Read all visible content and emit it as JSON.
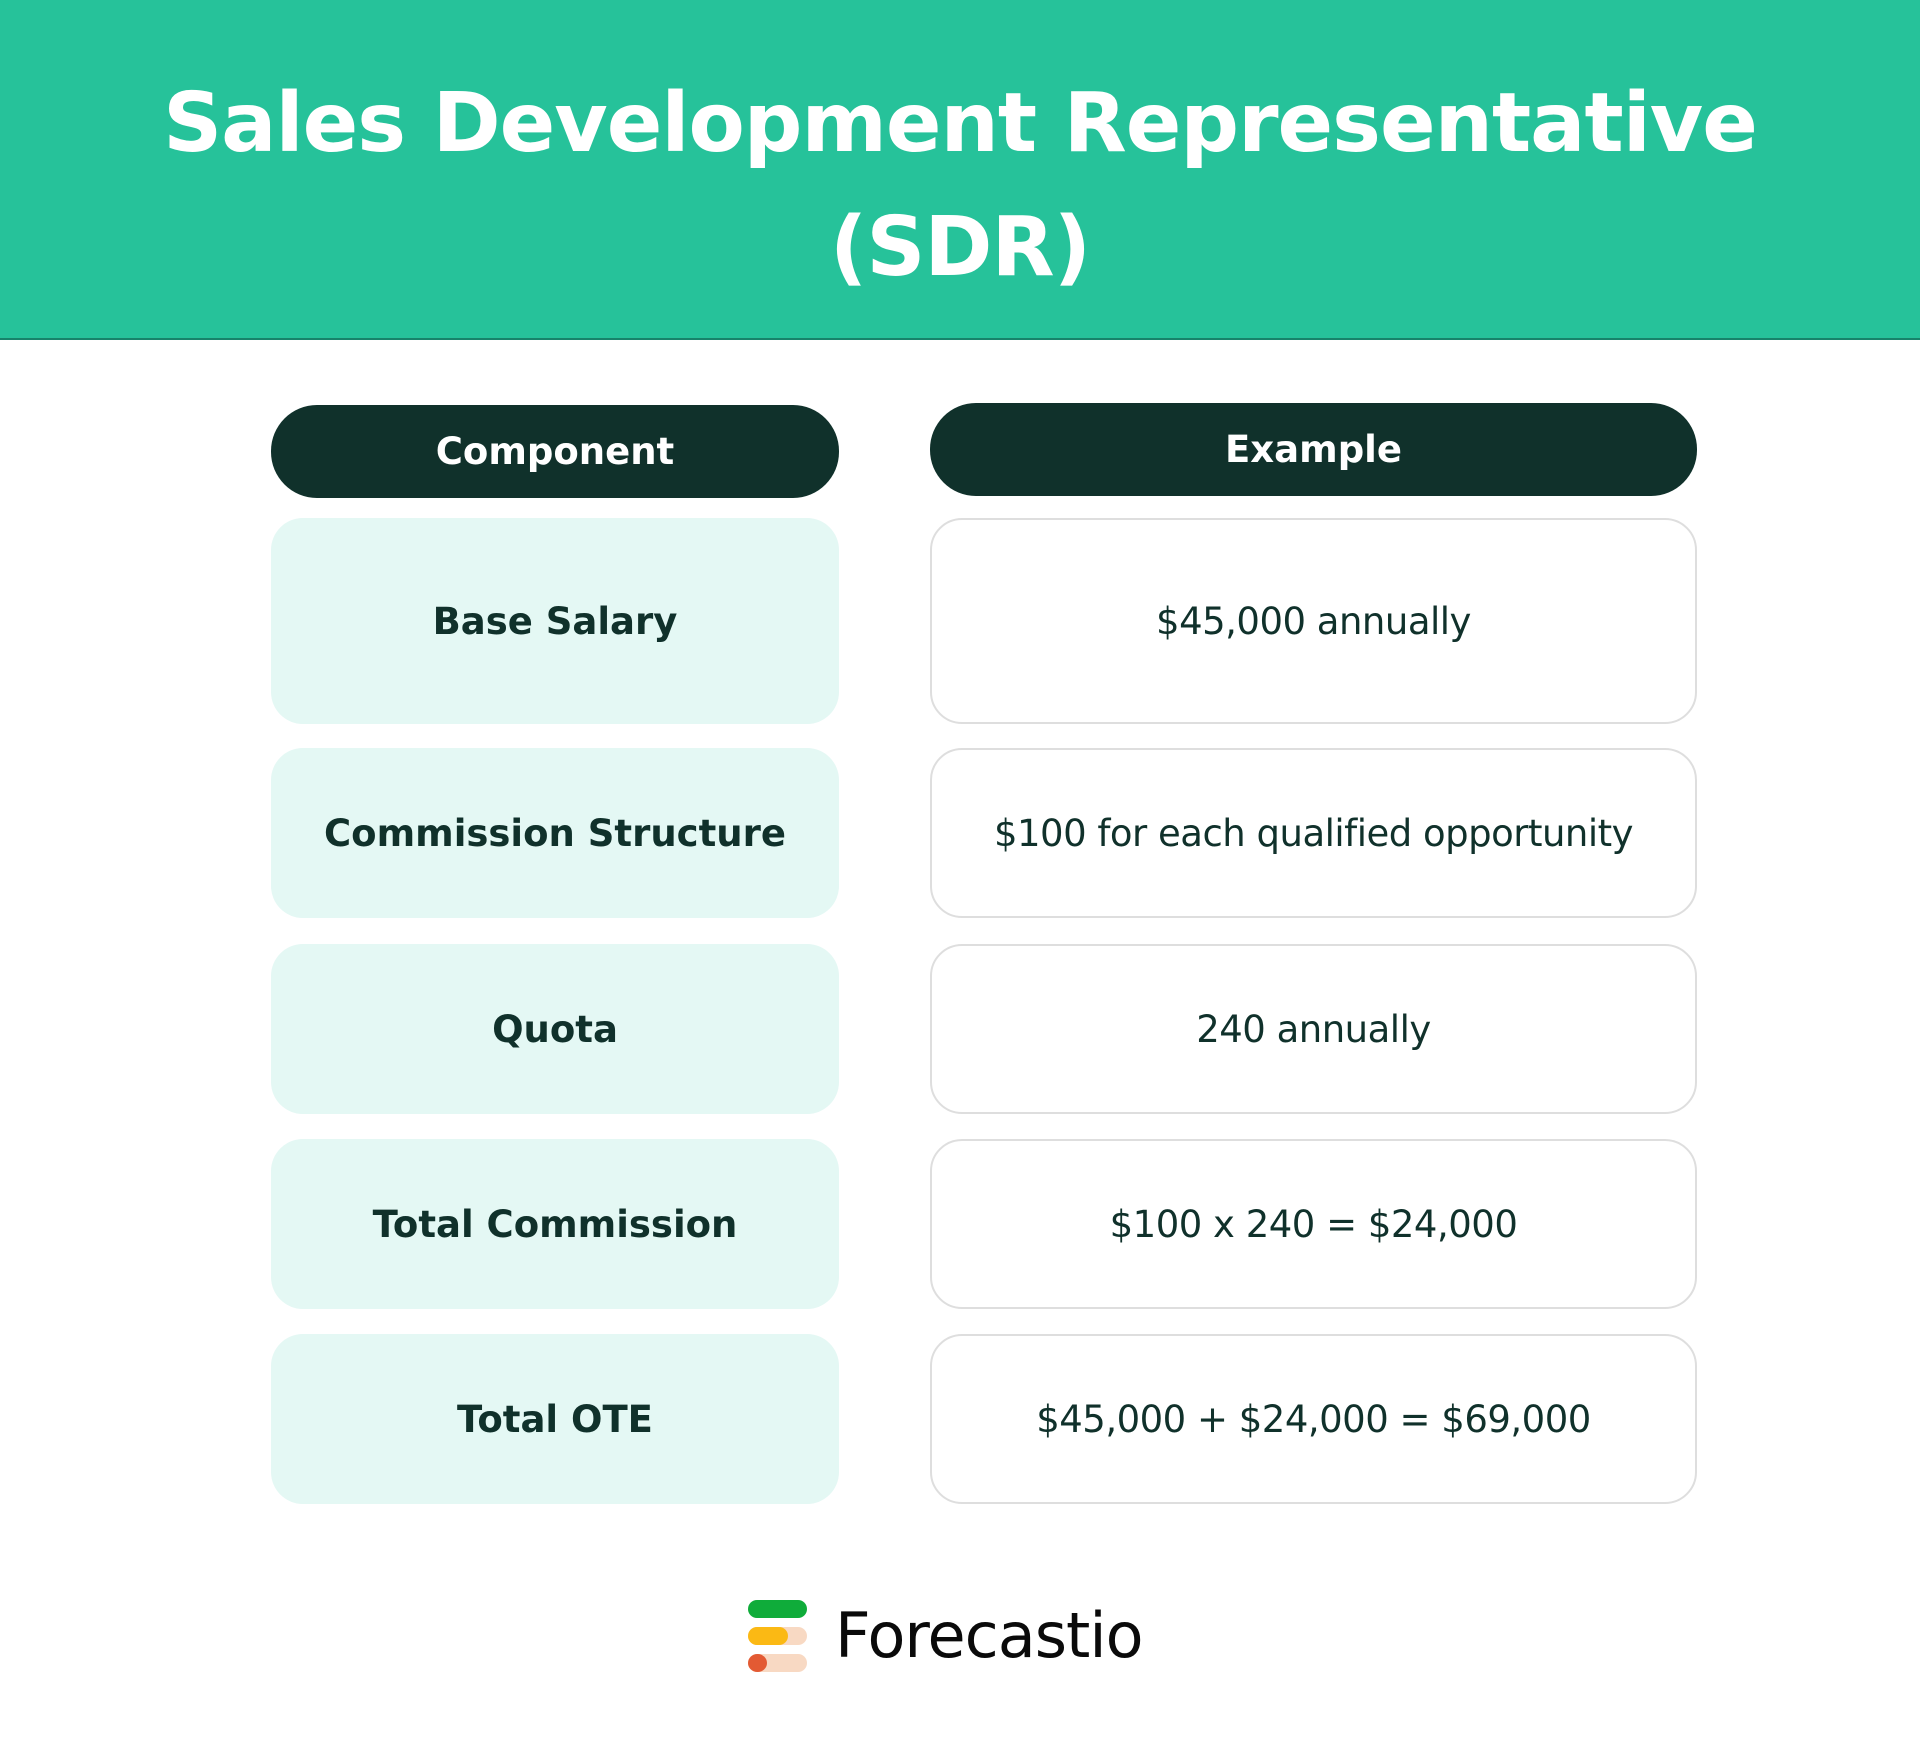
{
  "header": {
    "title_line1": "Sales Development Representative",
    "title_line2": "(SDR)",
    "background_color": "#26c29a"
  },
  "table": {
    "columns": [
      "Component",
      "Example"
    ],
    "rows": [
      {
        "component": "Base Salary",
        "example": "$45,000 annually"
      },
      {
        "component": "Commission Structure",
        "example": "$100 for each qualified opportunity"
      },
      {
        "component": "Quota",
        "example": "240 annually"
      },
      {
        "component": "Total Commission",
        "example": "$100 x 240 = $24,000"
      },
      {
        "component": "Total OTE",
        "example": "$45,000 + $24,000 = $69,000"
      }
    ],
    "header_color": "#10312b",
    "component_cell_color": "#e4f8f4"
  },
  "footer": {
    "logo_icon": "forecastio-bars-icon",
    "brand_name": "Forecastio",
    "logo_colors": [
      "#0fac3a",
      "#fbb914",
      "#e35a33",
      "#f8d9c3"
    ]
  }
}
